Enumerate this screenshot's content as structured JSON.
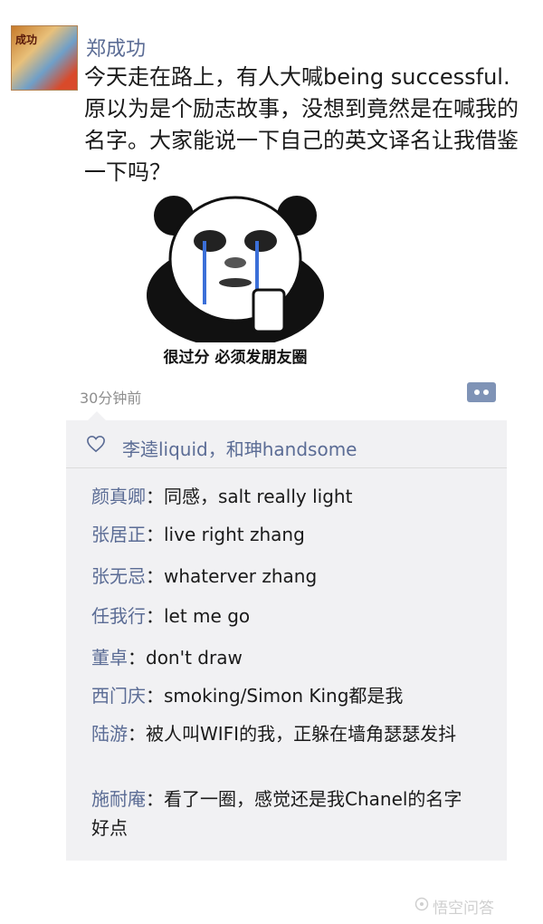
{
  "post": {
    "username": "郑成功",
    "avatar_text": "成功",
    "text": "今天走在路上，有人大喊being successful.原以为是个励志故事，没想到竟然是在喊我的名字。大家能说一下自己的英文译名让我借鉴一下吗？",
    "image_caption": "很过分 必须发朋友圈",
    "time": "30分钟前"
  },
  "likes": {
    "icon": "heart-icon",
    "text": "李逵liquid，和珅handsome"
  },
  "comments": [
    {
      "name": "颜真卿",
      "text": "：同感，salt really light"
    },
    {
      "name": "张居正",
      "text": "：live right zhang"
    },
    {
      "name": "张无忌",
      "text": "：whaterver zhang"
    },
    {
      "name": "任我行",
      "text": "：let me go"
    },
    {
      "name": "董卓",
      "text": "：don't draw"
    },
    {
      "name": "西门庆",
      "text": "：smoking/Simon King都是我"
    },
    {
      "name": "陆游",
      "text": "：被人叫WIFI的我，正躲在墙角瑟瑟发抖"
    },
    {
      "name": "施耐庵",
      "text": "：看了一圈，感觉还是我Chanel的名字好点"
    }
  ],
  "watermark": "悟空问答",
  "colors": {
    "name": "#5b6c95",
    "comment_bg": "#f1f1f3",
    "more_button": "#7f93b6"
  }
}
